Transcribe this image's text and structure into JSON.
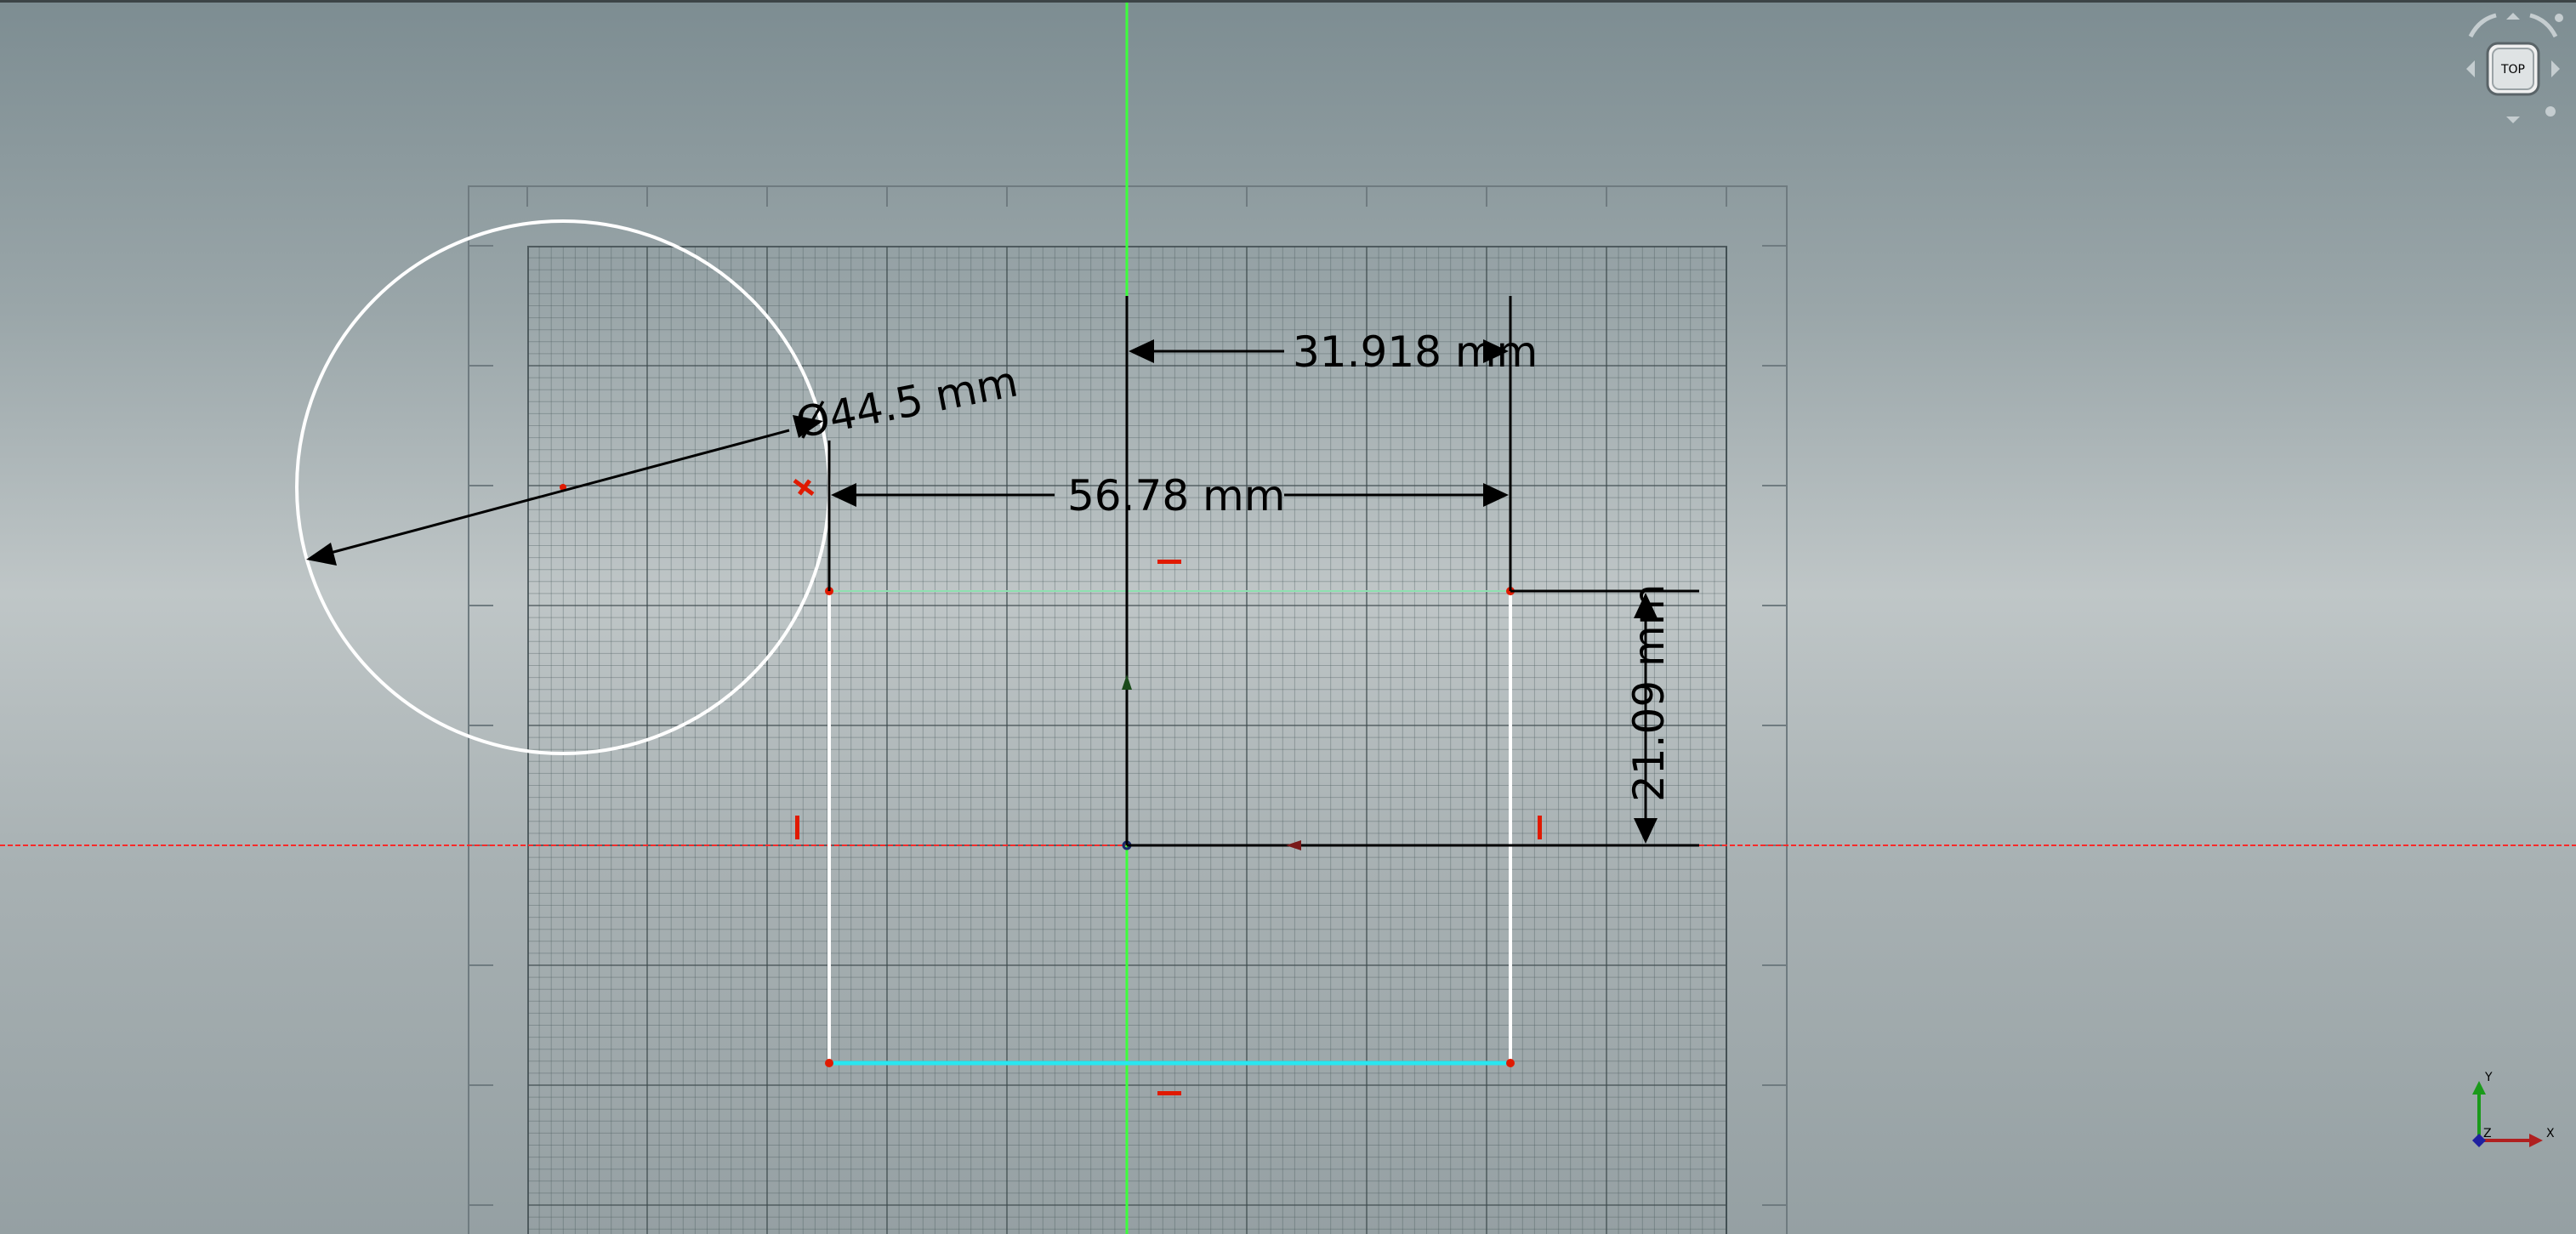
{
  "dimensions": {
    "horizontal_top": "31.918 mm",
    "horizontal_mid": "56.78 mm",
    "vertical": "21.09 mm",
    "diameter": "Ø44.5 mm"
  },
  "navcube": {
    "face_label": "TOP"
  },
  "axis_triad": {
    "x_label": "X",
    "y_label": "Y",
    "z_label": "Z"
  },
  "colors": {
    "background": "#9aa6a9",
    "x_axis": "#ff2a2a",
    "y_axis": "#3cff3c",
    "selected_edge": "#29e6f0",
    "construction_edge": "#8fe0b0",
    "geometry": "#ffffff",
    "constraint_marker": "#e01a00"
  }
}
